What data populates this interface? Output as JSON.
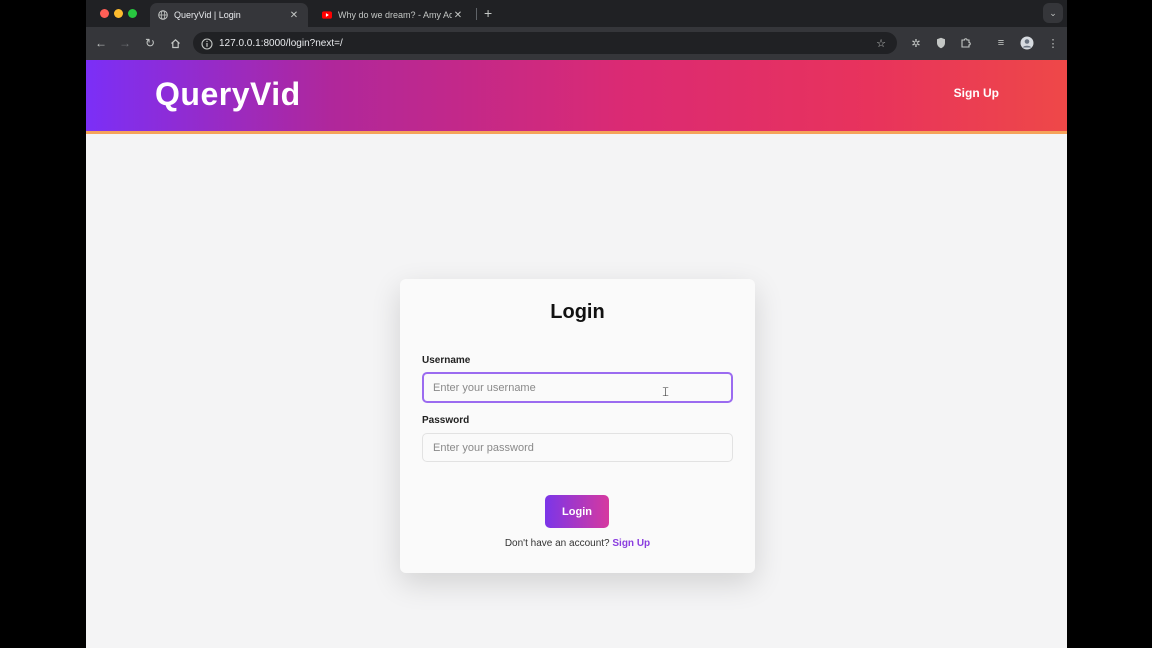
{
  "browser": {
    "tabs": [
      {
        "title": "QueryVid | Login",
        "active": true
      },
      {
        "title": "Why do we dream? - Amy Adkins",
        "active": false
      }
    ],
    "url": "127.0.0.1:8000/login?next=/"
  },
  "header": {
    "logo": "QueryVid",
    "signup_link": "Sign Up"
  },
  "login_form": {
    "title": "Login",
    "username_label": "Username",
    "username_placeholder": "Enter your username",
    "username_value": "",
    "password_label": "Password",
    "password_placeholder": "Enter your password",
    "password_value": "",
    "submit_label": "Login",
    "footer_prompt": "Don't have an account?",
    "footer_link": "Sign Up"
  },
  "colors": {
    "gradient_start": "#7b2ff7",
    "gradient_end": "#ee4848",
    "accent": "#8a3ddf"
  }
}
